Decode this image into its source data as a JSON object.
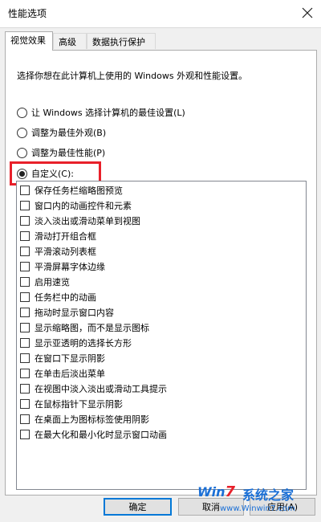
{
  "window": {
    "title": "性能选项"
  },
  "tabs": [
    {
      "label": "视觉效果",
      "active": true
    },
    {
      "label": "高级",
      "active": false
    },
    {
      "label": "数据执行保护",
      "active": false
    }
  ],
  "description": "选择你想在此计算机上使用的 Windows 外观和性能设置。",
  "options": [
    {
      "label": "让 Windows 选择计算机的最佳设置(L)",
      "selected": false
    },
    {
      "label": "调整为最佳外观(B)",
      "selected": false
    },
    {
      "label": "调整为最佳性能(P)",
      "selected": false
    },
    {
      "label": "自定义(C):",
      "selected": true
    }
  ],
  "effects": [
    {
      "label": "保存任务栏缩略图预览",
      "checked": false
    },
    {
      "label": "窗口内的动画控件和元素",
      "checked": false
    },
    {
      "label": "淡入淡出或滑动菜单到视图",
      "checked": false
    },
    {
      "label": "滑动打开组合框",
      "checked": false
    },
    {
      "label": "平滑滚动列表框",
      "checked": false
    },
    {
      "label": "平滑屏幕字体边缘",
      "checked": false
    },
    {
      "label": "启用速览",
      "checked": false
    },
    {
      "label": "任务栏中的动画",
      "checked": false
    },
    {
      "label": "拖动时显示窗口内容",
      "checked": false
    },
    {
      "label": "显示缩略图，而不是显示图标",
      "checked": false
    },
    {
      "label": "显示亚透明的选择长方形",
      "checked": false
    },
    {
      "label": "在窗口下显示阴影",
      "checked": false
    },
    {
      "label": "在单击后淡出菜单",
      "checked": false
    },
    {
      "label": "在视图中淡入淡出或滑动工具提示",
      "checked": false
    },
    {
      "label": "在鼠标指针下显示阴影",
      "checked": false
    },
    {
      "label": "在桌面上为图标标签使用阴影",
      "checked": false
    },
    {
      "label": "在最大化和最小化时显示窗口动画",
      "checked": false
    }
  ],
  "buttons": {
    "ok": "确定",
    "cancel": "取消",
    "apply": "应用(A)"
  },
  "watermark": {
    "logo_prefix": "Win",
    "logo_seven": "7",
    "site_name": "系统之家",
    "url": "www.Winwin7.com"
  },
  "colors": {
    "highlight": "#e8202a",
    "default_button_border": "#0078d7"
  }
}
